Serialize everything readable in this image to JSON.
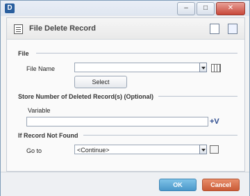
{
  "app": {
    "logo": "D",
    "window_controls": {
      "minimize": "–",
      "maximize": "□",
      "close": "✕"
    }
  },
  "panel": {
    "title": "File Delete Record",
    "icons": [
      "record-icon",
      "add-tool-icon",
      "copy-tool-icon"
    ]
  },
  "sections": {
    "file": {
      "label": "File",
      "file_name_label": "File Name",
      "file_name_value": "",
      "select_label": "Select"
    },
    "store": {
      "label": "Store Number of Deleted Record(s) (Optional)",
      "variable_label": "Variable",
      "variable_value": "",
      "variable_icon_text": "+V"
    },
    "not_found": {
      "label": "If Record Not Found",
      "goto_label": "Go to",
      "goto_value": "<Continue>"
    }
  },
  "footer": {
    "ok_label": "OK",
    "cancel_label": "Cancel"
  },
  "colors": {
    "ok": "#4a97c9",
    "cancel": "#c95a35",
    "accent": "#2a5f9e"
  }
}
